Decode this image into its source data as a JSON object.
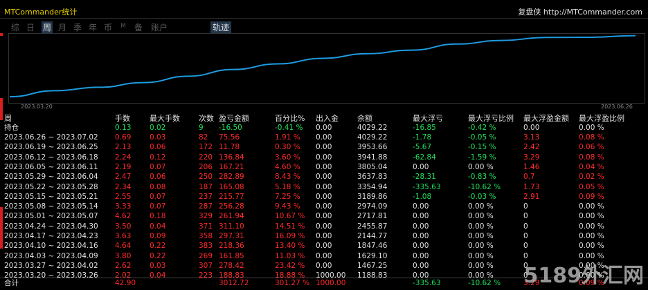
{
  "window": {
    "title": "MTCommander统计",
    "right_text": "复盘侠 http://MTCommander.com"
  },
  "tabs": [
    {
      "label": "综",
      "active": false
    },
    {
      "label": "日",
      "active": false
    },
    {
      "label": "周",
      "active": true
    },
    {
      "label": "月",
      "active": false
    },
    {
      "label": "季",
      "active": false
    },
    {
      "label": "年",
      "active": false
    },
    {
      "label": "币",
      "active": false
    },
    {
      "label": "M",
      "active": false
    },
    {
      "label": "备",
      "active": false
    },
    {
      "label": "账户",
      "active": false
    },
    {
      "label": "轨迹",
      "active": true
    }
  ],
  "chart_data": {
    "type": "line",
    "x_start": "2023.03.20",
    "x_end": "2023.06.26",
    "series": [
      {
        "values": [
          1188.83,
          1467.25,
          1629.1,
          1847.46,
          2144.77,
          2455.87,
          2717.81,
          2974.09,
          3189.86,
          3354.94,
          3637.83,
          3805.04,
          3941.88,
          3953.66,
          4029.22
        ],
        "color": "#1e9be0"
      }
    ]
  },
  "table": {
    "headers": [
      "周",
      "手数",
      "最大手数",
      "次数",
      "盈亏金额",
      "百分比%",
      "出入金",
      "余额",
      "最大浮亏",
      "最大浮亏比例",
      "最大浮盈金额",
      "最大浮盈比例"
    ],
    "position_row": [
      "持仓",
      "0.13",
      "0.02",
      "9",
      "-16.50",
      "-0.41 %",
      "0.00",
      "4029.22",
      "-16.85",
      "-0.42 %",
      "0.00",
      "0.00 %"
    ],
    "rows": [
      [
        "2023.06.26 ~ 2023.07.02",
        "0.69",
        "0.03",
        "82",
        "75.56",
        "1.91 %",
        "0.00",
        "4029.22",
        "-1.78",
        "-0.05 %",
        "3.13",
        "0.08 %"
      ],
      [
        "2023.06.19 ~ 2023.06.25",
        "2.13",
        "0.06",
        "172",
        "11.78",
        "0.30 %",
        "0.00",
        "3953.66",
        "-5.67",
        "-0.15 %",
        "2.42",
        "0.06 %"
      ],
      [
        "2023.06.12 ~ 2023.06.18",
        "2.24",
        "0.12",
        "220",
        "136.84",
        "3.60 %",
        "0.00",
        "3941.88",
        "-62.84",
        "-1.59 %",
        "3.29",
        "0.08 %"
      ],
      [
        "2023.06.05 ~ 2023.06.11",
        "2.19",
        "0.07",
        "206",
        "167.21",
        "4.60 %",
        "0.00",
        "3805.04",
        "0.00",
        "0.00 %",
        "1.46",
        "0.04 %"
      ],
      [
        "2023.05.29 ~ 2023.06.04",
        "2.47",
        "0.06",
        "250",
        "282.89",
        "8.43 %",
        "0.00",
        "3637.83",
        "-28.31",
        "-0.83 %",
        "0.7",
        "0.02 %"
      ],
      [
        "2023.05.22 ~ 2023.05.28",
        "2.34",
        "0.08",
        "187",
        "165.08",
        "5.18 %",
        "0.00",
        "3354.94",
        "-335.63",
        "-10.62 %",
        "1.73",
        "0.05 %"
      ],
      [
        "2023.05.15 ~ 2023.05.21",
        "2.55",
        "0.07",
        "237",
        "215.77",
        "7.25 %",
        "0.00",
        "3189.86",
        "-1.08",
        "-0.03 %",
        "2.91",
        "0.09 %"
      ],
      [
        "2023.05.08 ~ 2023.05.14",
        "3.33",
        "0.07",
        "287",
        "256.28",
        "9.43 %",
        "0.00",
        "2974.09",
        "0.00",
        "0.00 %",
        "0",
        "0.00 %"
      ],
      [
        "2023.05.01 ~ 2023.05.07",
        "4.62",
        "0.18",
        "329",
        "261.94",
        "10.67 %",
        "0.00",
        "2717.81",
        "0.00",
        "0.00 %",
        "0",
        "0.00 %"
      ],
      [
        "2023.04.24 ~ 2023.04.30",
        "3.50",
        "0.04",
        "371",
        "311.10",
        "14.51 %",
        "0.00",
        "2455.87",
        "0.00",
        "0.00 %",
        "0",
        "0.00 %"
      ],
      [
        "2023.04.17 ~ 2023.04.23",
        "3.63",
        "0.09",
        "358",
        "297.31",
        "16.09 %",
        "0.00",
        "2144.77",
        "0.00",
        "0.00 %",
        "0",
        "0.00 %"
      ],
      [
        "2023.04.10 ~ 2023.04.16",
        "4.64",
        "0.22",
        "383",
        "218.36",
        "13.40 %",
        "0.00",
        "1847.46",
        "0.00",
        "0.00 %",
        "0",
        "0.00 %"
      ],
      [
        "2023.04.03 ~ 2023.04.09",
        "3.80",
        "0.22",
        "269",
        "161.85",
        "11.03 %",
        "0.00",
        "1629.10",
        "0.00",
        "0.00 %",
        "0",
        "0.00 %"
      ],
      [
        "2023.03.27 ~ 2023.04.02",
        "2.62",
        "0.03",
        "307",
        "278.42",
        "23.42 %",
        "0.00",
        "1467.25",
        "0.00",
        "0.00 %",
        "0",
        "0.00 %"
      ],
      [
        "2023.03.20 ~ 2023.03.26",
        "2.02",
        "0.04",
        "223",
        "188.83",
        "18.88 %",
        "1000.00",
        "1188.83",
        "0.00",
        "0.00 %",
        "0",
        "0.00 %"
      ]
    ],
    "total_row": [
      "合计",
      "42.90",
      "",
      "",
      "3012.72",
      "301.27 %",
      "1000.00",
      "",
      "-335.63",
      "-10.62 %",
      "3.29",
      "0.09 %"
    ]
  },
  "colors": {
    "positive": "#ff2a2a",
    "negative": "#22e05a",
    "neutral": "#e0e0e0",
    "line": "#1e9be0"
  },
  "watermark": "5189外汇网"
}
